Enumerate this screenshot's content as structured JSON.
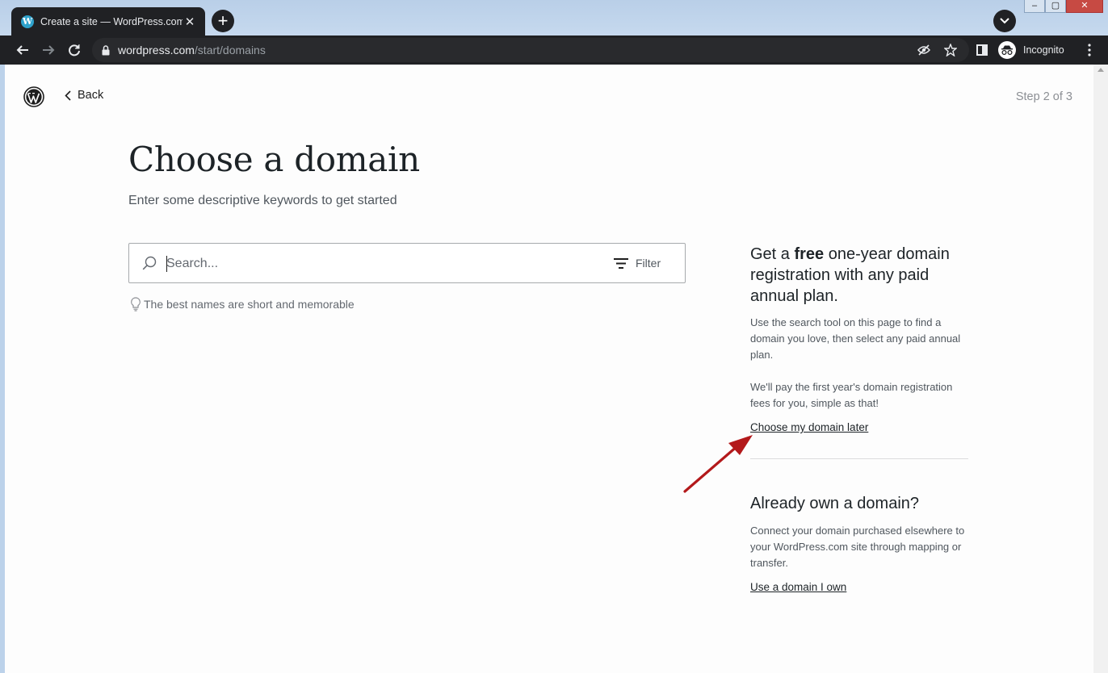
{
  "browser": {
    "tab_title": "Create a site — WordPress.com",
    "url_host": "wordpress.com",
    "url_path": "/start/domains",
    "profile_label": "Incognito",
    "window_controls": [
      "–",
      "▢",
      "✕"
    ]
  },
  "header": {
    "back_label": "Back",
    "step_text": "Step 2 of 3"
  },
  "main": {
    "heading": "Choose a domain",
    "subheading": "Enter some descriptive keywords to get started",
    "search_placeholder": "Search...",
    "filter_label": "Filter",
    "hint": "The best names are short and memorable"
  },
  "sidebar": {
    "promo_before": "Get a ",
    "promo_bold": "free",
    "promo_after": " one-year domain registration with any paid annual plan.",
    "promo_p1": "Use the search tool on this page to find a domain you love, then select any paid annual plan.",
    "promo_p2": "We'll pay the first year's domain registration fees for you, simple as that!",
    "later_link": "Choose my domain later",
    "own_title": "Already own a domain?",
    "own_p": "Connect your domain purchased elsewhere to your WordPress.com site through mapping or transfer.",
    "own_link": "Use a domain I own"
  },
  "colors": {
    "annotation_arrow": "#b3191b",
    "toolbar": "#202124",
    "tabstrip": "#bcd2ea"
  }
}
